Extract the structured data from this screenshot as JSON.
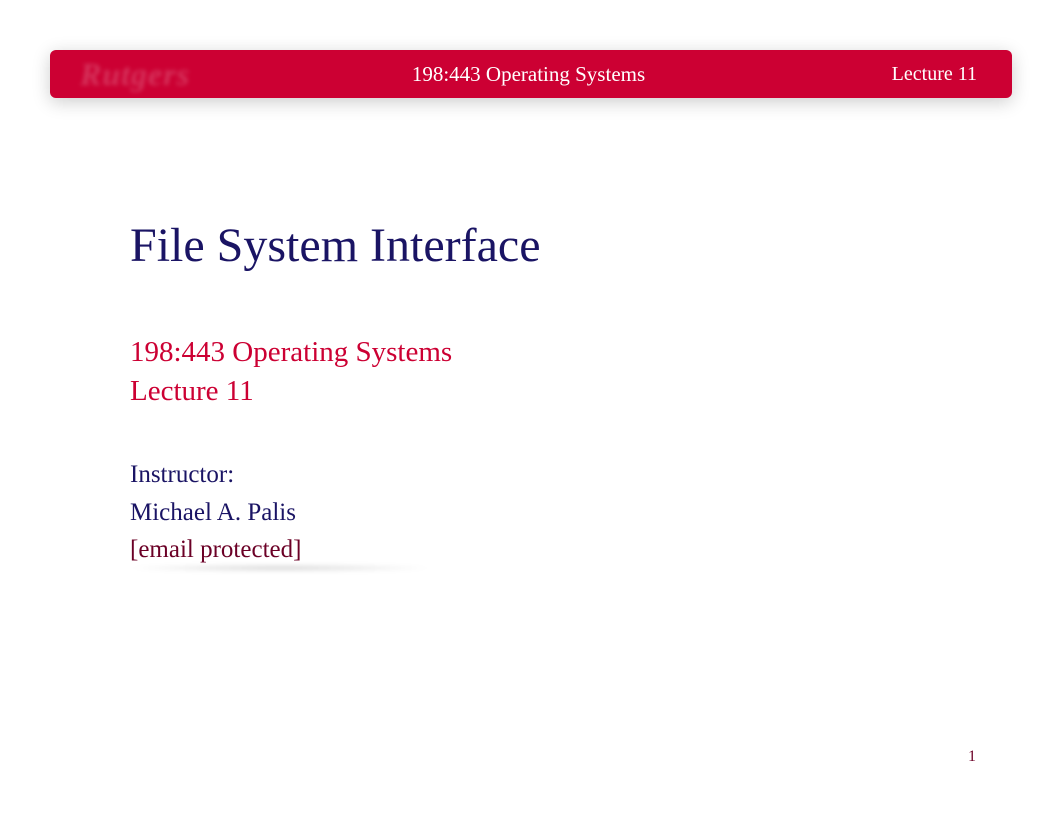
{
  "header": {
    "logo_text": "Rutgers",
    "course": "198:443 Operating Systems",
    "lecture": "Lecture 11"
  },
  "content": {
    "title": "File System Interface",
    "course_sub": "198:443 Operating Systems",
    "lecture_sub": "Lecture 11",
    "instructor_label": "Instructor:",
    "instructor_name": "Michael A. Palis",
    "email": "[email protected]"
  },
  "footer": {
    "page_number": "1"
  }
}
